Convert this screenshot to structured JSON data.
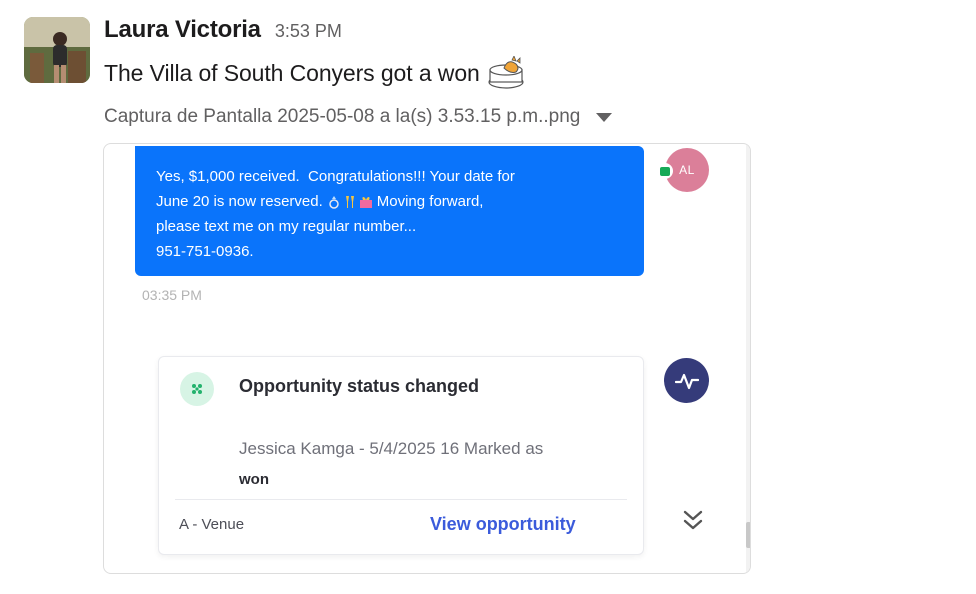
{
  "message": {
    "author": "Laura Victoria",
    "timestamp": "3:53 PM",
    "text": "The Villa of South Conyers got a won",
    "emoji_icon": "cat-cake-emoji"
  },
  "attachment": {
    "filename": "Captura de Pantalla 2025-05-08 a la(s) 3.53.15 p.m..png"
  },
  "chat_bubble": {
    "line1": "Yes, $1,000 received.  Congratulations!!! Your date for",
    "line2_before": "June 20 is now reserved.",
    "line2_after": "Moving forward,",
    "line3": "please text me on my regular number...",
    "line4": "951-751-0936.",
    "time": "03:35 PM",
    "avatar_initials": "AL",
    "colors": {
      "bubble": "#0a74fb",
      "avatar": "#db7f99"
    }
  },
  "activity_card": {
    "title": "Opportunity status changed",
    "description": "Jessica Kamga - 5/4/2025 16 Marked as",
    "status": "won",
    "pipeline": "A - Venue",
    "link_label": "View opportunity",
    "colors": {
      "link": "#3b5bdb",
      "icon_bg": "#d7f4e5",
      "avatar": "#353b7a"
    }
  }
}
